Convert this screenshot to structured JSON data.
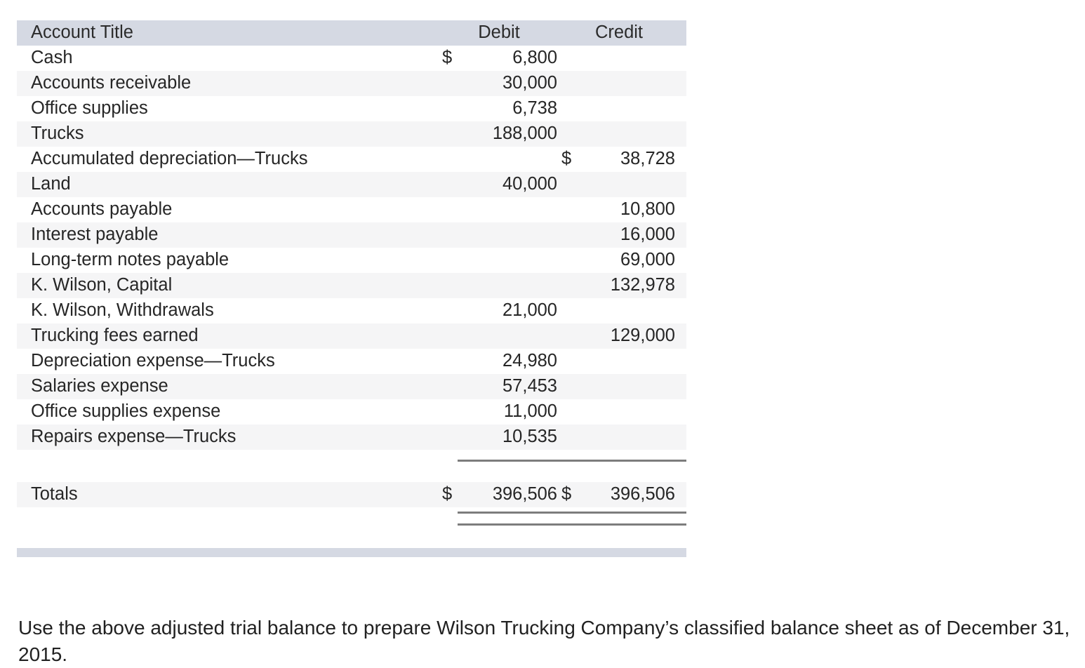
{
  "table": {
    "headers": {
      "title": "Account Title",
      "debit": "Debit",
      "credit": "Credit"
    },
    "currency_symbol": "$",
    "rows": [
      {
        "title": "Cash",
        "debit_sign": "$",
        "debit": "6,800",
        "credit_sign": "",
        "credit": ""
      },
      {
        "title": "Accounts receivable",
        "debit_sign": "",
        "debit": "30,000",
        "credit_sign": "",
        "credit": ""
      },
      {
        "title": "Office supplies",
        "debit_sign": "",
        "debit": "6,738",
        "credit_sign": "",
        "credit": ""
      },
      {
        "title": "Trucks",
        "debit_sign": "",
        "debit": "188,000",
        "credit_sign": "",
        "credit": ""
      },
      {
        "title": "Accumulated depreciation—Trucks",
        "debit_sign": "",
        "debit": "",
        "credit_sign": "$",
        "credit": "38,728"
      },
      {
        "title": "Land",
        "debit_sign": "",
        "debit": "40,000",
        "credit_sign": "",
        "credit": ""
      },
      {
        "title": "Accounts payable",
        "debit_sign": "",
        "debit": "",
        "credit_sign": "",
        "credit": "10,800"
      },
      {
        "title": "Interest payable",
        "debit_sign": "",
        "debit": "",
        "credit_sign": "",
        "credit": "16,000"
      },
      {
        "title": "Long-term notes payable",
        "debit_sign": "",
        "debit": "",
        "credit_sign": "",
        "credit": "69,000"
      },
      {
        "title": "K. Wilson, Capital",
        "debit_sign": "",
        "debit": "",
        "credit_sign": "",
        "credit": "132,978"
      },
      {
        "title": "K. Wilson, Withdrawals",
        "debit_sign": "",
        "debit": "21,000",
        "credit_sign": "",
        "credit": ""
      },
      {
        "title": "Trucking fees earned",
        "debit_sign": "",
        "debit": "",
        "credit_sign": "",
        "credit": "129,000"
      },
      {
        "title": "Depreciation expense—Trucks",
        "debit_sign": "",
        "debit": "24,980",
        "credit_sign": "",
        "credit": ""
      },
      {
        "title": "Salaries expense",
        "debit_sign": "",
        "debit": "57,453",
        "credit_sign": "",
        "credit": ""
      },
      {
        "title": "Office supplies expense",
        "debit_sign": "",
        "debit": "11,000",
        "credit_sign": "",
        "credit": ""
      },
      {
        "title": "Repairs expense—Trucks",
        "debit_sign": "",
        "debit": "10,535",
        "credit_sign": "",
        "credit": ""
      }
    ],
    "totals": {
      "title": "Totals",
      "debit_sign": "$",
      "debit": "396,506",
      "credit_sign": "$",
      "credit": "396,506"
    }
  },
  "instruction": {
    "text": "Use the above adjusted trial balance to prepare Wilson Trucking Company’s classified balance sheet as of December 31, 2015."
  },
  "colors": {
    "header_band": "#d5d9e3",
    "row_shade": "#f5f5f6",
    "rule": "#7d7d7d",
    "text": "#262626"
  }
}
